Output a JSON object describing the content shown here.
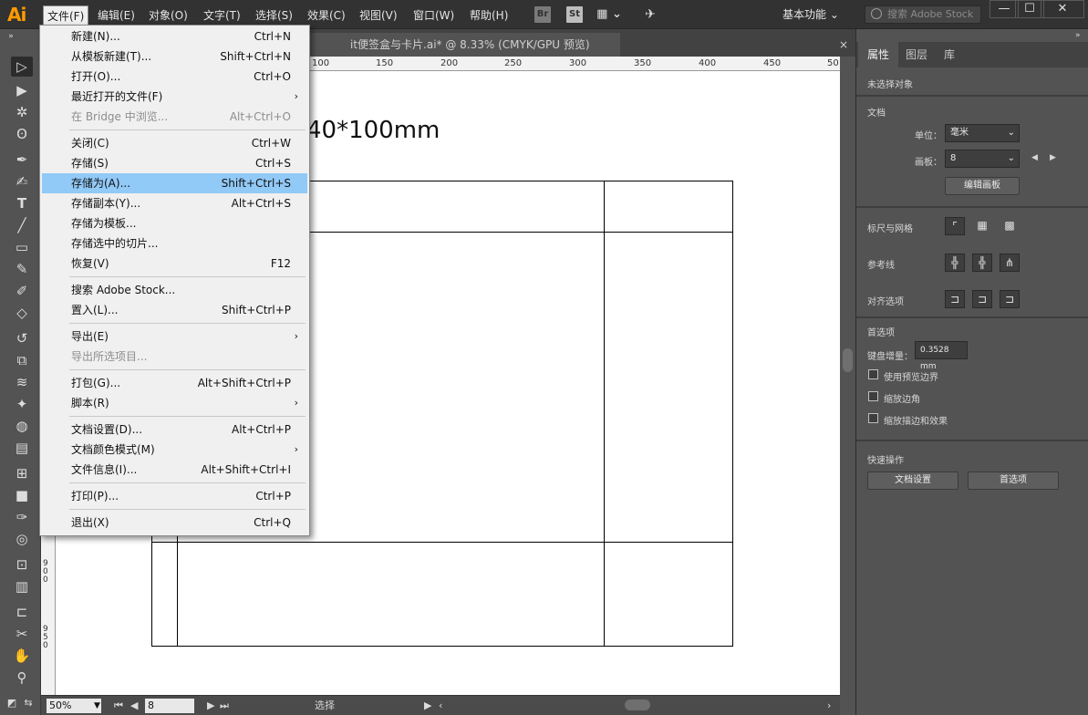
{
  "app": {
    "logo": "Ai"
  },
  "menubar": {
    "items": [
      "文件(F)",
      "编辑(E)",
      "对象(O)",
      "文字(T)",
      "选择(S)",
      "效果(C)",
      "视图(V)",
      "窗口(W)",
      "帮助(H)"
    ],
    "bridge_label": "Br",
    "stock_label": "St",
    "workspace": "基本功能",
    "search_placeholder": "搜索 Adobe Stock"
  },
  "tab": {
    "title": "it便签盒与卡片.ai* @ 8.33% (CMYK/GPU 预览)",
    "close": "×"
  },
  "ruler_top_labels": [
    "100",
    "150",
    "200",
    "250",
    "300",
    "350",
    "400",
    "450",
    "50"
  ],
  "ruler_left_labels": [
    "900",
    "950"
  ],
  "canvas": {
    "title": "40*100mm"
  },
  "file_menu": [
    {
      "label": "新建(N)...",
      "shortcut": "Ctrl+N"
    },
    {
      "label": "从模板新建(T)...",
      "shortcut": "Shift+Ctrl+N"
    },
    {
      "label": "打开(O)...",
      "shortcut": "Ctrl+O"
    },
    {
      "label": "最近打开的文件(F)",
      "shortcut": "",
      "arrow": "›"
    },
    {
      "label": "在 Bridge 中浏览...",
      "shortcut": "Alt+Ctrl+O",
      "disabled": true
    },
    {
      "label": "关闭(C)",
      "shortcut": "Ctrl+W"
    },
    {
      "label": "存储(S)",
      "shortcut": "Ctrl+S"
    },
    {
      "label": "存储为(A)...",
      "shortcut": "Shift+Ctrl+S",
      "highlight": true
    },
    {
      "label": "存储副本(Y)...",
      "shortcut": "Alt+Ctrl+S"
    },
    {
      "label": "存储为模板...",
      "shortcut": ""
    },
    {
      "label": "存储选中的切片...",
      "shortcut": ""
    },
    {
      "label": "恢复(V)",
      "shortcut": "F12"
    },
    {
      "label": "搜索 Adobe Stock...",
      "shortcut": ""
    },
    {
      "label": "置入(L)...",
      "shortcut": "Shift+Ctrl+P"
    },
    {
      "label": "导出(E)",
      "shortcut": "",
      "arrow": "›"
    },
    {
      "label": "导出所选项目...",
      "shortcut": "",
      "disabled": true
    },
    {
      "label": "打包(G)...",
      "shortcut": "Alt+Shift+Ctrl+P"
    },
    {
      "label": "脚本(R)",
      "shortcut": "",
      "arrow": "›"
    },
    {
      "label": "文档设置(D)...",
      "shortcut": "Alt+Ctrl+P"
    },
    {
      "label": "文档颜色模式(M)",
      "shortcut": "",
      "arrow": "›"
    },
    {
      "label": "文件信息(I)...",
      "shortcut": "Alt+Shift+Ctrl+I"
    },
    {
      "label": "打印(P)...",
      "shortcut": "Ctrl+P"
    },
    {
      "label": "退出(X)",
      "shortcut": "Ctrl+Q"
    }
  ],
  "status": {
    "zoom": "50%",
    "page": "8",
    "tool": "选择"
  },
  "panel": {
    "tabs": [
      "属性",
      "图层",
      "库"
    ],
    "no_selection": "未选择对象",
    "document_label": "文档",
    "unit_label": "单位：",
    "unit_value": "毫米",
    "artboard_label": "画板：",
    "artboard_value": "8",
    "edit_artboard_btn": "编辑画板",
    "rulers_grids_label": "标尺与网格",
    "guides_label": "参考线",
    "align_label": "对齐选项",
    "prefs_label": "首选项",
    "keyboard_increment_label": "键盘增量：",
    "keyboard_increment_value": "0.3528 mm",
    "use_preview_bounds": "使用预览边界",
    "scale_corners": "缩放边角",
    "scale_strokes": "缩放描边和效果",
    "quick_actions_label": "快速操作",
    "doc_setup_btn": "文档设置",
    "prefs_btn": "首选项"
  }
}
